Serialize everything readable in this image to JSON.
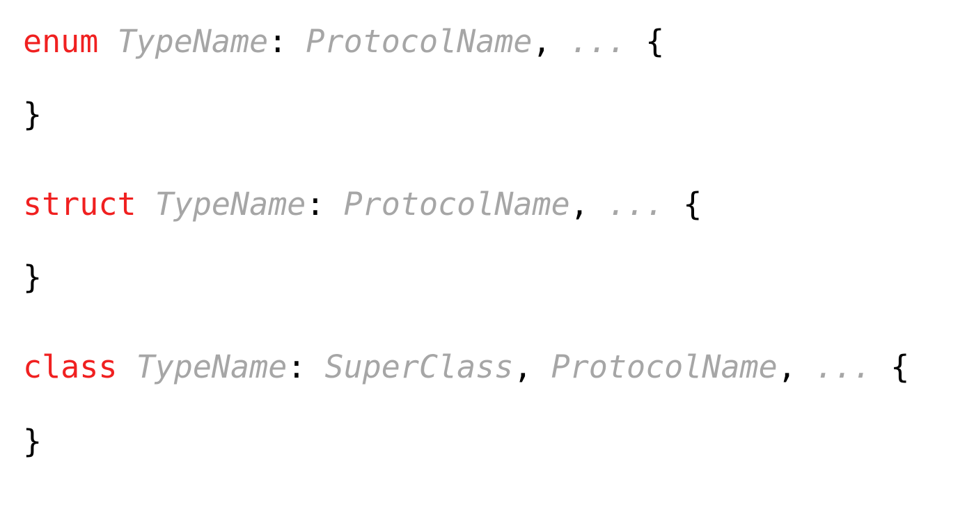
{
  "colors": {
    "keyword": "#f02020",
    "placeholder": "#a6a6a6",
    "punctuation": "#000000",
    "background": "#ffffff"
  },
  "lines": [
    {
      "keyword": "enum",
      "type_name": "TypeName",
      "colon": ":",
      "protocol": "ProtocolName",
      "comma": ",",
      "ellipsis": "...",
      "open_brace": "{"
    },
    {
      "close_brace": "}"
    },
    {
      "keyword": "struct",
      "type_name": "TypeName",
      "colon": ":",
      "protocol": "ProtocolName",
      "comma": ",",
      "ellipsis": "...",
      "open_brace": "{"
    },
    {
      "close_brace": "}"
    },
    {
      "keyword": "class",
      "type_name": "TypeName",
      "colon": ":",
      "superclass": "SuperClass",
      "comma1": ",",
      "protocol": "ProtocolName",
      "comma2": ",",
      "ellipsis": "...",
      "open_brace": "{"
    },
    {
      "close_brace": "}"
    }
  ]
}
